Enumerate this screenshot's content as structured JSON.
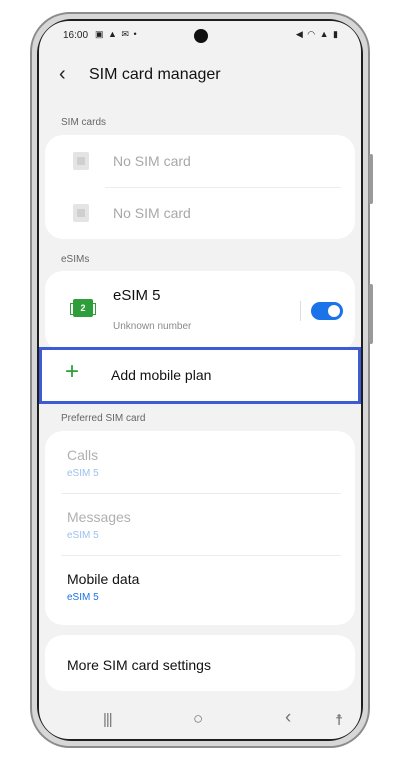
{
  "status_bar": {
    "time": "16:00",
    "left_icons": "▣ ▲ ✉ •",
    "right_icons": "◀ ◠ ▲ ▮"
  },
  "header": {
    "back_glyph": "‹",
    "title": "SIM card manager"
  },
  "sim_cards": {
    "section_label": "SIM cards",
    "items": [
      {
        "label": "No SIM card"
      },
      {
        "label": "No SIM card"
      }
    ]
  },
  "esims": {
    "section_label": "eSIMs",
    "item": {
      "badge": "2",
      "name": "eSIM 5",
      "subtitle": "Unknown number",
      "enabled": true
    },
    "add_plan_label": "Add mobile plan",
    "add_plan_icon": "+"
  },
  "preferred_sim": {
    "section_label": "Preferred SIM card",
    "items": [
      {
        "title": "Calls",
        "value": "eSIM 5",
        "enabled": false
      },
      {
        "title": "Messages",
        "value": "eSIM 5",
        "enabled": false
      },
      {
        "title": "Mobile data",
        "value": "eSIM 5",
        "enabled": true
      }
    ]
  },
  "more_settings": {
    "label": "More SIM card settings"
  },
  "nav_bar": {
    "recents": "|||",
    "home": "○",
    "back": "‹",
    "accessibility": "☨"
  },
  "colors": {
    "accent": "#1a73e8",
    "esim_green": "#2e9e3a",
    "highlight": "#3e5bd6"
  }
}
